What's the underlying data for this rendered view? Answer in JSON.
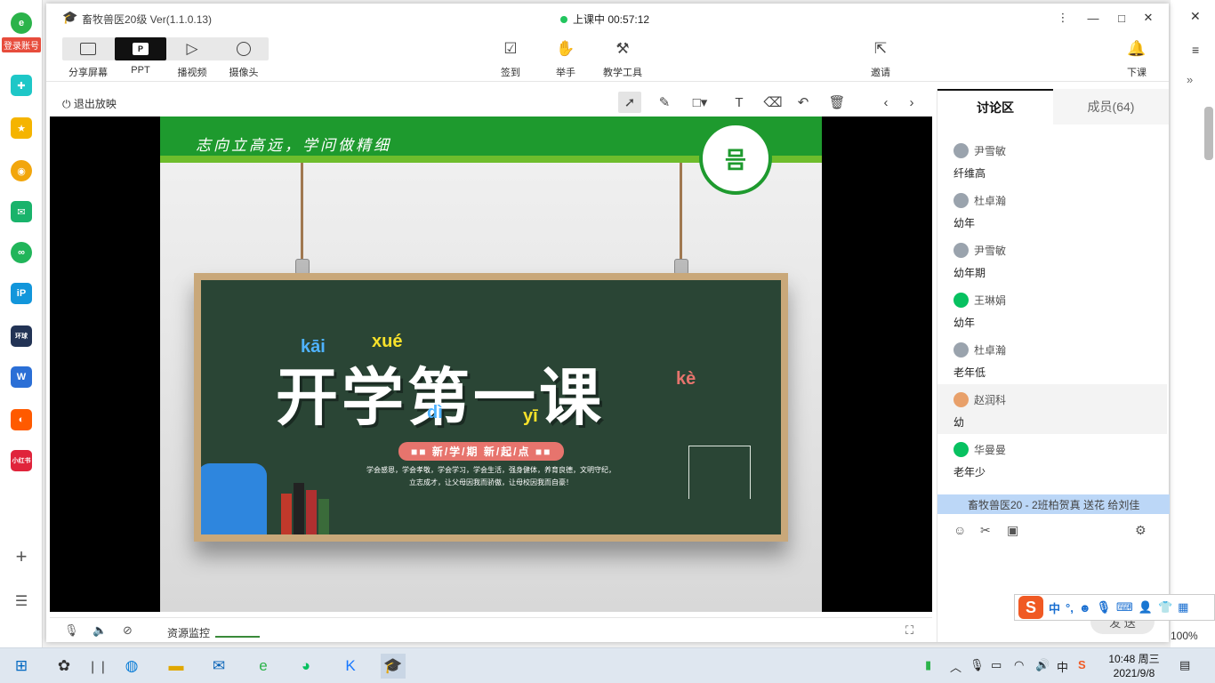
{
  "left_bar": {
    "login_badge": "登录账号"
  },
  "window": {
    "title": "畜牧兽医20级 Ver(1.1.0.13)",
    "status": "上课中 00:57:12",
    "controls": {
      "more": "⋮",
      "minimize": "—",
      "maximize": "□",
      "close": "✕"
    }
  },
  "toolbar": {
    "share_screen": "分享屏幕",
    "ppt": "PPT",
    "play_video": "播视频",
    "camera": "摄像头",
    "sign_in": "签到",
    "raise_hand": "举手",
    "teaching_tools": "教学工具",
    "invite": "邀请",
    "end_class": "下课"
  },
  "subbar": {
    "exit_show": "退出放映"
  },
  "slide": {
    "motto": "志向立高远，学问做精细",
    "seal_text": "믐",
    "title": "开学第一课",
    "pinyin": [
      "kāi",
      "xué",
      "dì",
      "yī",
      "kè"
    ],
    "pill": "■■ 新/学/期   新/起/点 ■■",
    "line1": "学会感恩，学会孝敬，学会学习，学会生活，强身健体，养育良德，文明守纪，",
    "line2": "立志成才，让父母因我而骄傲，让母校因我而自豪！"
  },
  "control_bar": {
    "resource_monitor": "资源监控"
  },
  "chat": {
    "tab_discussion": "讨论区",
    "tab_members": "成员(64)",
    "messages": [
      {
        "name": "尹雪敏",
        "text": "纤维高"
      },
      {
        "name": "杜卓瀚",
        "text": "幼年"
      },
      {
        "name": "尹雪敏",
        "text": "幼年期"
      },
      {
        "name": "王琳娟",
        "text": "幼年"
      },
      {
        "name": "杜卓瀚",
        "text": "老年低"
      },
      {
        "name": "赵润科",
        "text": "幼"
      },
      {
        "name": "华曼曼",
        "text": "老年少"
      }
    ],
    "notice": "畜牧兽医20 - 2班柏贺真 送花 给刘佳",
    "send": "发 送"
  },
  "ime": {
    "logo": "S",
    "mode": "中"
  },
  "zoom": "100%",
  "clock": {
    "time": "10:48 周三",
    "date": "2021/9/8"
  },
  "tray": {
    "ime_lang": "中"
  },
  "colors": {
    "banner_green": "#1e9a2e",
    "board": "#2a4535",
    "live_dot": "#22c55e",
    "notice_bg": "#bcd7f7",
    "ime_orange": "#f05a24"
  }
}
